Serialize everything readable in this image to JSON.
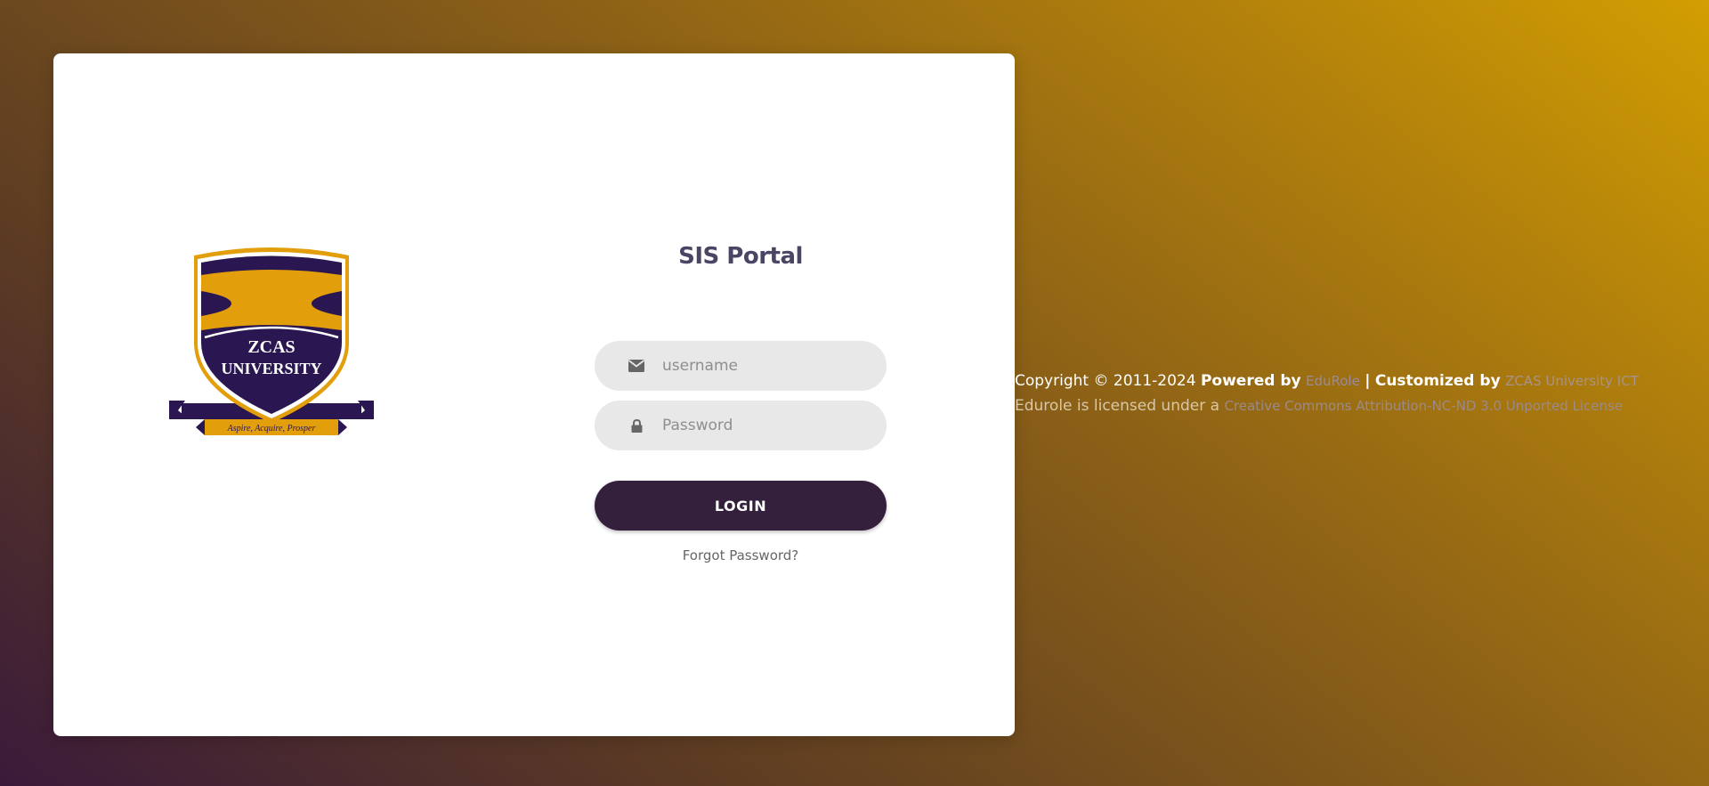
{
  "logo": {
    "top_text": "ZCAS",
    "bottom_text": "UNIVERSITY",
    "motto": "Aspire, Acquire, Prosper",
    "colors": {
      "purple": "#2a1752",
      "gold": "#e39e0c",
      "white": "#ffffff"
    }
  },
  "login": {
    "title": "SIS Portal",
    "username_placeholder": "username",
    "password_placeholder": "Password",
    "login_label": "LOGIN",
    "forgot_label": "Forgot Password?",
    "icons": {
      "username": "envelope-icon",
      "password": "lock-icon"
    }
  },
  "footer": {
    "copyright": "Copyright © 2011-2024",
    "powered_by": "Powered by",
    "edurole_link": "EduRole",
    "separator": "|",
    "customized_by": "Customized by",
    "ict_link": "ZCAS University ICT",
    "license_prefix": "Edurole is licensed under a",
    "license_link": "Creative Commons Attribution-NC-ND 3.0 Unported License"
  },
  "colors": {
    "button": "#34203d",
    "title": "#4b4565",
    "field_bg": "#e8e8e8"
  }
}
